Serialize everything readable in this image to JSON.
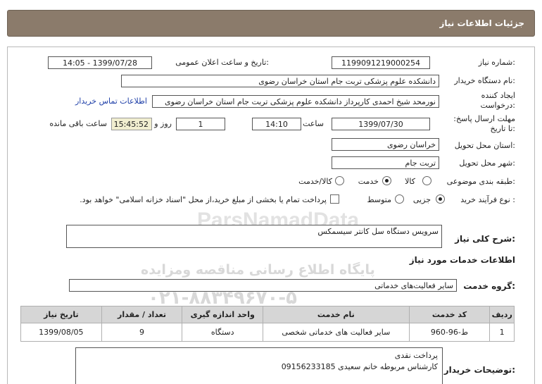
{
  "header": {
    "title": "جزئیات اطلاعات نیاز"
  },
  "labels": {
    "need_number": "شماره نیاز:",
    "announce_datetime": "تاریخ و ساعت اعلان عمومی:",
    "buyer_org": "نام دستگاه خریدار:",
    "creator": "ایجاد کننده درخواست:",
    "deadline": "مهلت ارسال پاسخ: تا تاریخ:",
    "time_word": "ساعت",
    "day_word": "روز و",
    "remaining": "ساعت باقی مانده",
    "province": "استان محل تحویل:",
    "city": "شهر محل تحویل:",
    "category": "طبقه بندی موضوعی:",
    "purchase_type": "نوع فرآیند خرید :",
    "description": "شرح کلی نیاز:",
    "services_info": "اطلاعات خدمات مورد نیاز",
    "service_group": "گروه خدمت:",
    "buyer_notes": "توضیحات خریدار:"
  },
  "values": {
    "need_number": "1199091219000254",
    "announce_datetime": "1399/07/28 - 14:05",
    "buyer_org": "دانشکده علوم پزشکی تربت جام استان خراسان رضوی",
    "creator": "نورمحد شیخ احمدی کارپرداز دانشکده علوم پزشکی تربت جام استان خراسان رضوی",
    "contact_link": "اطلاعات تماس خریدار",
    "deadline_date": "1399/07/30",
    "deadline_time": "14:10",
    "days": "1",
    "remaining_time": "15:45:52",
    "province": "خراسان رضوی",
    "city": "تربت جام",
    "description": "سرویس دستگاه سل کانتر سیسمکس",
    "service_group": "سایر فعالیت‌های خدماتی"
  },
  "category_options": [
    {
      "label": "کالا",
      "selected": false
    },
    {
      "label": "خدمت",
      "selected": true
    },
    {
      "label": "کالا/خدمت",
      "selected": false
    }
  ],
  "purchase_options": [
    {
      "label": "جزیی",
      "selected": true
    },
    {
      "label": "متوسط",
      "selected": false
    }
  ],
  "payment_note": "پرداخت تمام یا بخشی از مبلغ خرید،از محل \"اسناد خزانه اسلامی\" خواهد بود.",
  "table": {
    "headers": [
      "ردیف",
      "کد خدمت",
      "نام خدمت",
      "واحد اندازه گیری",
      "تعداد / مقدار",
      "تاریخ نیاز"
    ],
    "rows": [
      [
        "1",
        "ط-96-960",
        "سایر فعالیت های خدماتی شخصی",
        "دستگاه",
        "9",
        "1399/08/05"
      ]
    ]
  },
  "buyer_notes": {
    "line1": "پرداخت نقدی",
    "line2": "کارشناس مربوطه خانم سعیدی 09156233185"
  },
  "watermark": {
    "line1": "ParsNamadData",
    "line2": "مرکز فراوری اطلاعات پارس نماد داده ها",
    "line3": "پایگاه اطلاع رسانی مناقصه ومزایده",
    "line4": "۰۲۱-۸۸۳۴۹۶۷۰-۵"
  }
}
